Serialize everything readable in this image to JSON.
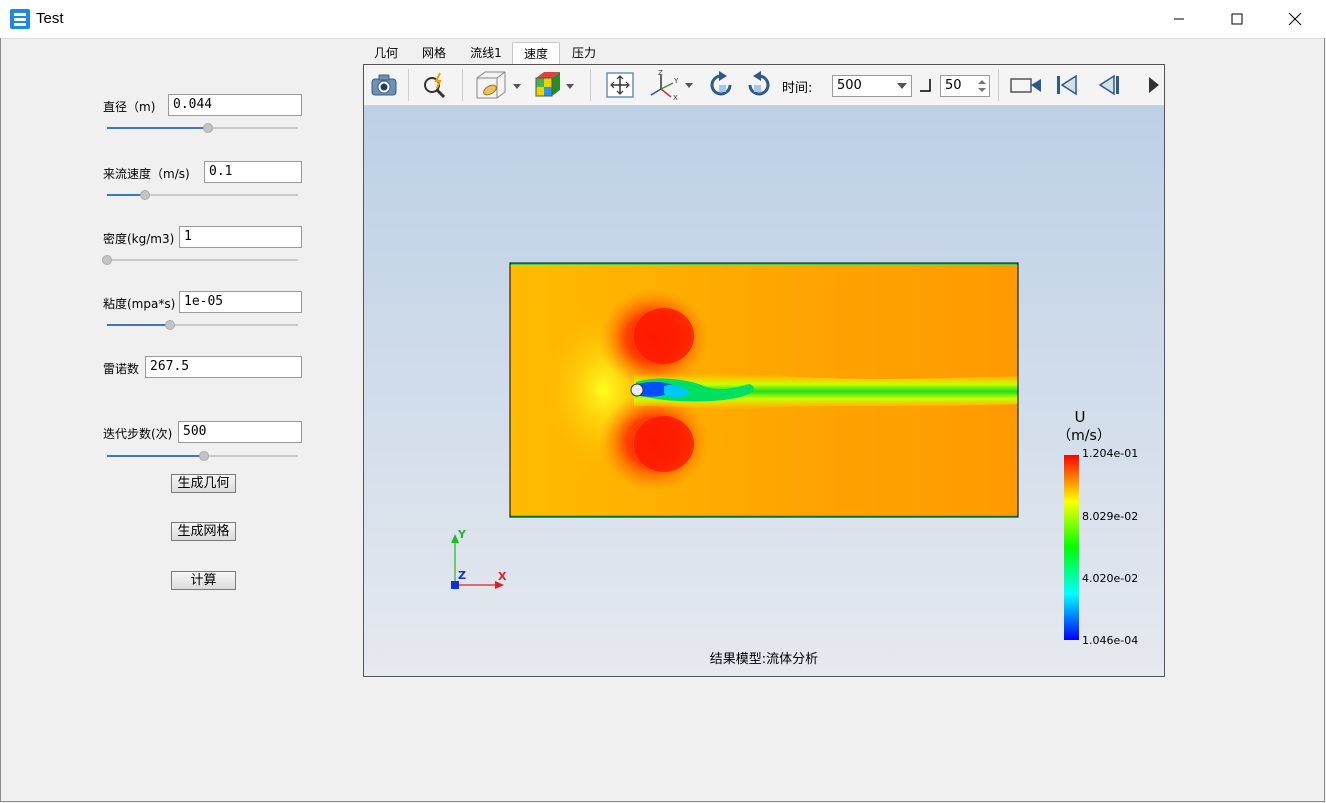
{
  "window": {
    "title": "Test"
  },
  "params": {
    "diameter": {
      "label": "直径（m)",
      "value": "0.044",
      "slider": 0.53
    },
    "inflow_velocity": {
      "label": "来流速度（m/s)",
      "value": "0.1",
      "slider": 0.2
    },
    "density": {
      "label": "密度(kg/m3)",
      "value": "1",
      "slider": 0.0
    },
    "viscosity": {
      "label": "粘度(mpa*s)",
      "value": "1e-05",
      "slider": 0.33
    },
    "reynolds": {
      "label": "雷诺数",
      "value": "267.5"
    },
    "iterations": {
      "label": "迭代步数(次)",
      "value": "500",
      "slider": 0.51
    }
  },
  "buttons": {
    "gen_geometry": "生成几何",
    "gen_mesh": "生成网格",
    "compute": "计算"
  },
  "tabs": [
    {
      "label": "几何"
    },
    {
      "label": "网格"
    },
    {
      "label": "流线1"
    },
    {
      "label": "速度",
      "active": true
    },
    {
      "label": "压力"
    }
  ],
  "toolbar": {
    "time_label": "时间:",
    "time_value": "500",
    "step_value": "50",
    "icons": [
      "camera-icon",
      "zoom-icon",
      "view-box-icon",
      "color-cube-icon",
      "fit-view-icon",
      "axes-icon",
      "rotate-left-icon",
      "rotate-right-icon",
      "record-icon",
      "first-frame-icon",
      "prev-frame-icon",
      "play-icon"
    ]
  },
  "legend": {
    "title": "U",
    "unit": "（m/s）",
    "ticks": [
      "1.204e-01",
      "8.029e-02",
      "4.020e-02",
      "1.046e-04"
    ],
    "colors": [
      "#ff0000",
      "#ffff00",
      "#00ff00",
      "#00ffff",
      "#0000ff"
    ]
  },
  "axes": {
    "x": "X",
    "y": "Y",
    "z": "Z"
  },
  "caption": "结果模型:流体分析",
  "colors": {
    "accent": "#3d77c0"
  }
}
